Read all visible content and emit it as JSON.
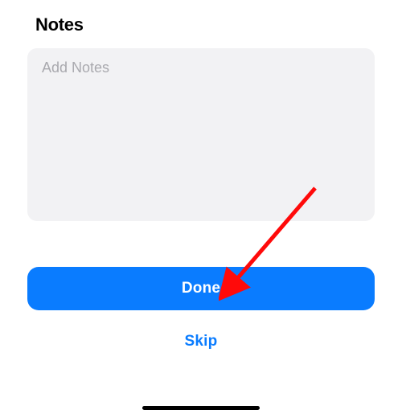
{
  "header": {
    "title": "Notes"
  },
  "notes": {
    "placeholder": "Add Notes",
    "value": ""
  },
  "actions": {
    "done_label": "Done",
    "skip_label": "Skip"
  },
  "colors": {
    "primary": "#0a7cff",
    "input_bg": "#f2f2f4",
    "placeholder": "#a9a9ae"
  },
  "annotation": {
    "arrow_color": "#ff0a0a"
  }
}
